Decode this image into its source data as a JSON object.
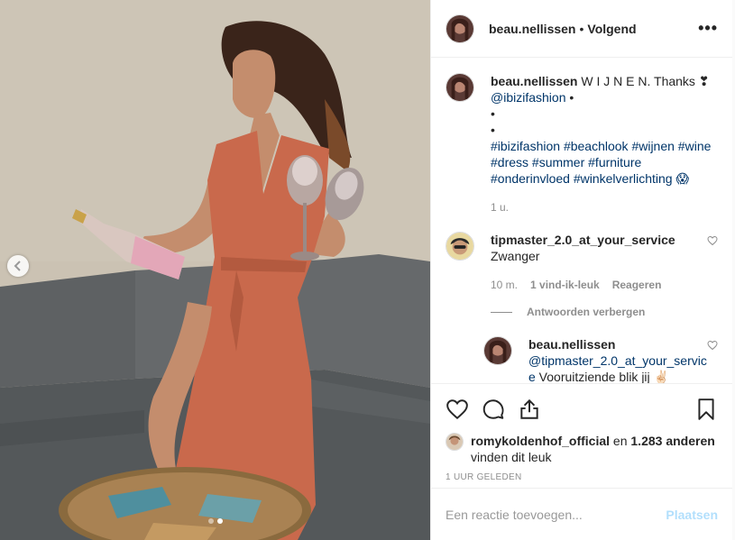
{
  "post": {
    "author": "beau.nellissen",
    "separator": "•",
    "follow_status": "Volgend",
    "more_icon": "ellipsis-icon",
    "more_label": "•••"
  },
  "caption": {
    "user": "beau.nellissen",
    "line1_text": "W I J N E N. Thanks ❣",
    "mention": "@ibizifashion",
    "mention_suffix": " •",
    "bullet1": "•",
    "bullet2": "•",
    "hashtags": "#ibizifashion #beachlook #wijnen #wine #dress #summer #furniture #onderinvloed #winkelverlichting 😱",
    "time": "1 u."
  },
  "comment1": {
    "user": "tipmaster_2.0_at_your_service",
    "text": "Zwanger",
    "time": "10 m.",
    "likes": "1 vind-ik-leuk",
    "reply_label": "Reageren",
    "hide_replies": "Antwoorden verbergen"
  },
  "reply1": {
    "user": "beau.nellissen",
    "mention": "@tipmaster_2.0_at_your_service",
    "text": " Vooruitziende blik jij ✌🏻"
  },
  "likes_block": {
    "user": "romykoldenhof_official",
    "and": " en ",
    "count": "1.283 anderen",
    "line2": "vinden dit leuk"
  },
  "timestamp": "1 UUR GELEDEN",
  "comment_input": {
    "placeholder": "Een reactie toevoegen...",
    "value": ""
  },
  "post_button": "Plaatsen",
  "carousel": {
    "slide_count": 2,
    "current_slide": 1
  },
  "colors": {
    "link": "#003569",
    "muted": "#8e8e8e",
    "post_button_disabled": "#b2dffc"
  }
}
